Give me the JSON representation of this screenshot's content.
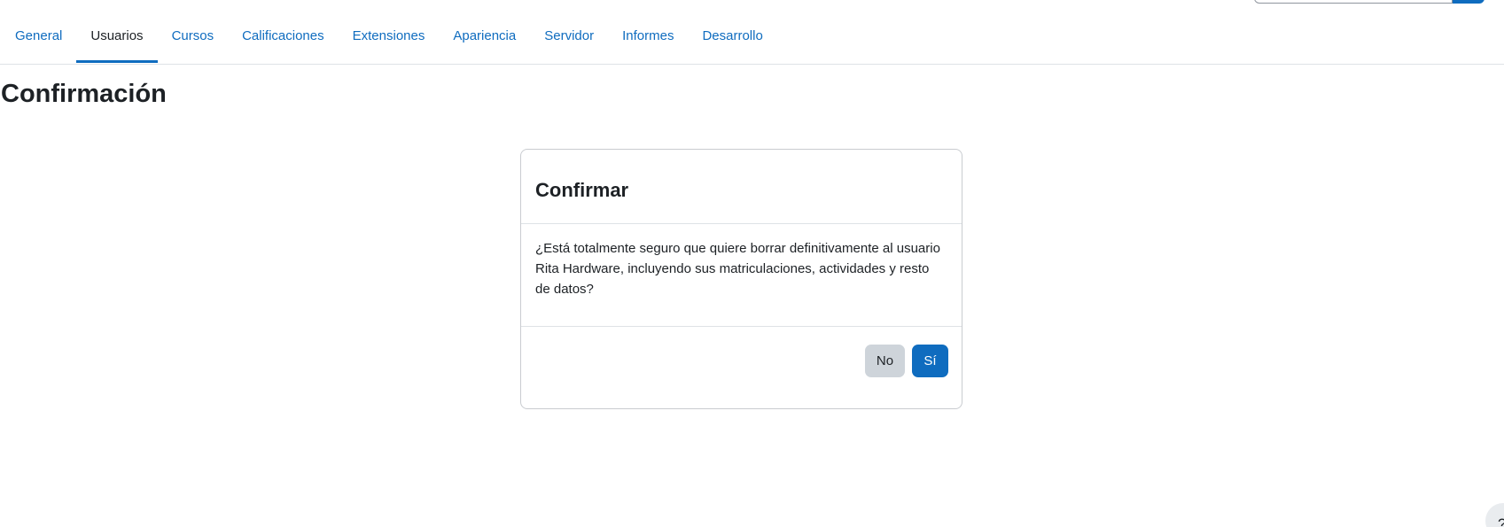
{
  "nav": {
    "tabs": [
      {
        "label": "General"
      },
      {
        "label": "Usuarios",
        "active": true
      },
      {
        "label": "Cursos"
      },
      {
        "label": "Calificaciones"
      },
      {
        "label": "Extensiones"
      },
      {
        "label": "Apariencia"
      },
      {
        "label": "Servidor"
      },
      {
        "label": "Informes"
      },
      {
        "label": "Desarrollo"
      }
    ]
  },
  "page": {
    "title": "Confirmación"
  },
  "dialog": {
    "title": "Confirmar",
    "message": "¿Está totalmente seguro que quiere borrar definitivamente al usuario Rita Hardware, incluyendo sus matriculaciones, actividades y resto de datos?",
    "no_label": "No",
    "yes_label": "Sí"
  },
  "help": {
    "label": "?"
  },
  "colors": {
    "accent": "#0f6cbf",
    "text": "#1d2125",
    "secondary_button": "#ced4da",
    "border": "#dee2e6"
  },
  "icons": {
    "search": "search-icon",
    "help": "question-mark-icon"
  }
}
